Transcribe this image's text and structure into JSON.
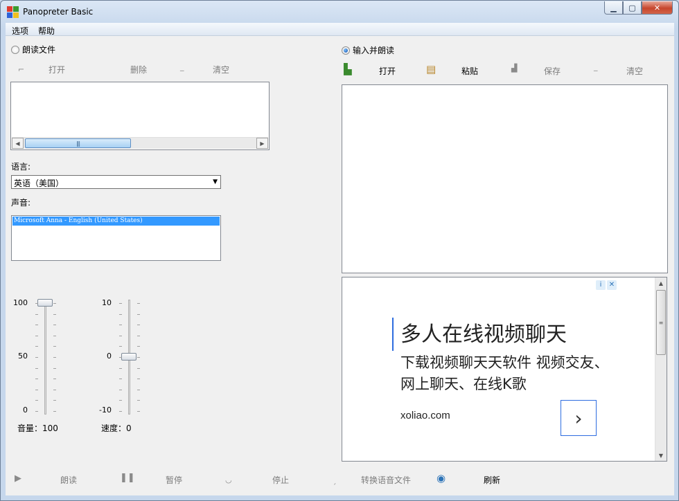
{
  "window": {
    "title": "Panopreter Basic",
    "minimize": "▁",
    "maximize": "▢",
    "close": "✕"
  },
  "menu": [
    "选项",
    "帮助"
  ],
  "left": {
    "mode_label": "朗读文件",
    "toolbar": {
      "open": "打开",
      "delete": "删除",
      "clear": "清空"
    },
    "language_label": "语言:",
    "language_value": "英语（美国）",
    "voice_label": "声音:",
    "voice_selected": "Microsoft Anna - English (United States)",
    "volume": {
      "ticks": [
        "100",
        "50",
        "0"
      ],
      "caption": "音量：100",
      "value": 100
    },
    "speed": {
      "ticks": [
        "10",
        "0",
        "-10"
      ],
      "caption": "速度：0",
      "value": 0
    }
  },
  "right": {
    "mode_label": "输入并朗读",
    "toolbar": {
      "open": "打开",
      "paste": "粘贴",
      "save": "保存",
      "clear": "清空"
    }
  },
  "ad": {
    "title": "多人在线视频聊天",
    "description": "下载视频聊天天软件 视频交友、网上聊天、在线K歌",
    "url": "xoliao.com",
    "arrow": "›"
  },
  "bottom": {
    "read": "朗读",
    "pause": "暂停",
    "stop": "停止",
    "convert": "转换语音文件",
    "refresh": "刷新"
  }
}
